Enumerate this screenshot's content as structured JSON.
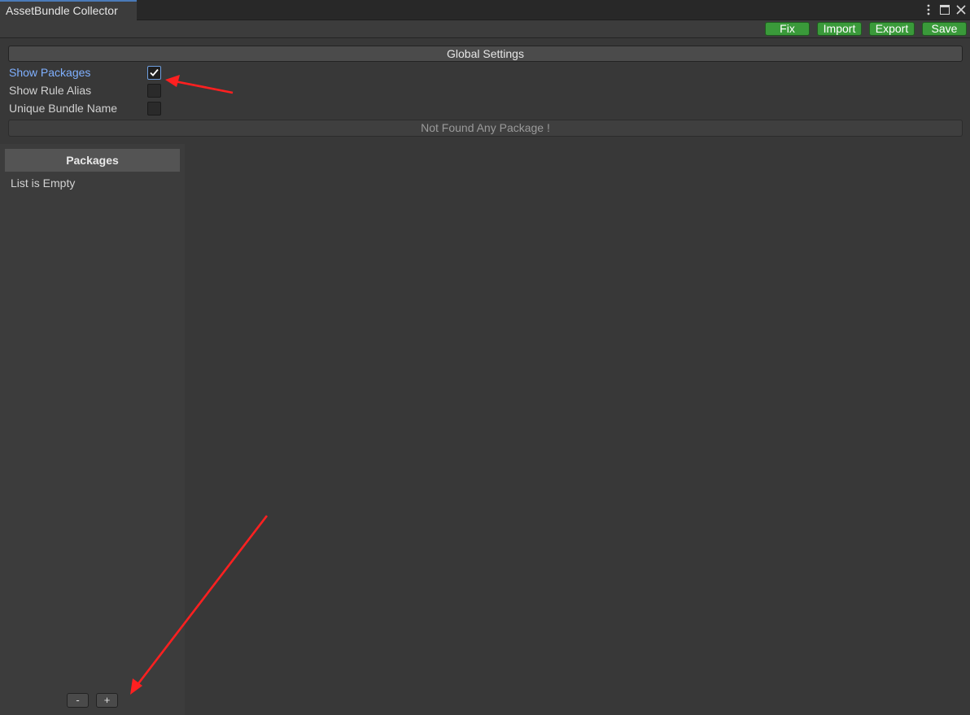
{
  "window": {
    "tab_title": "AssetBundle Collector",
    "icons": [
      "more-vertical-icon",
      "maximize-icon",
      "close-icon"
    ]
  },
  "toolbar": {
    "fix_label": "Fix",
    "import_label": "Import",
    "export_label": "Export",
    "save_label": "Save",
    "button_color": "#3a9a3a"
  },
  "settings": {
    "global_label": "Global Settings",
    "options": [
      {
        "label": "Show Packages",
        "checked": true
      },
      {
        "label": "Show Rule Alias",
        "checked": false
      },
      {
        "label": "Unique Bundle Name",
        "checked": false
      }
    ],
    "status_text": "Not Found Any Package !"
  },
  "packages": {
    "header": "Packages",
    "empty_text": "List is Empty",
    "remove_label": "-",
    "add_label": "+"
  },
  "annotations": {
    "arrow_color": "#ff2020"
  }
}
